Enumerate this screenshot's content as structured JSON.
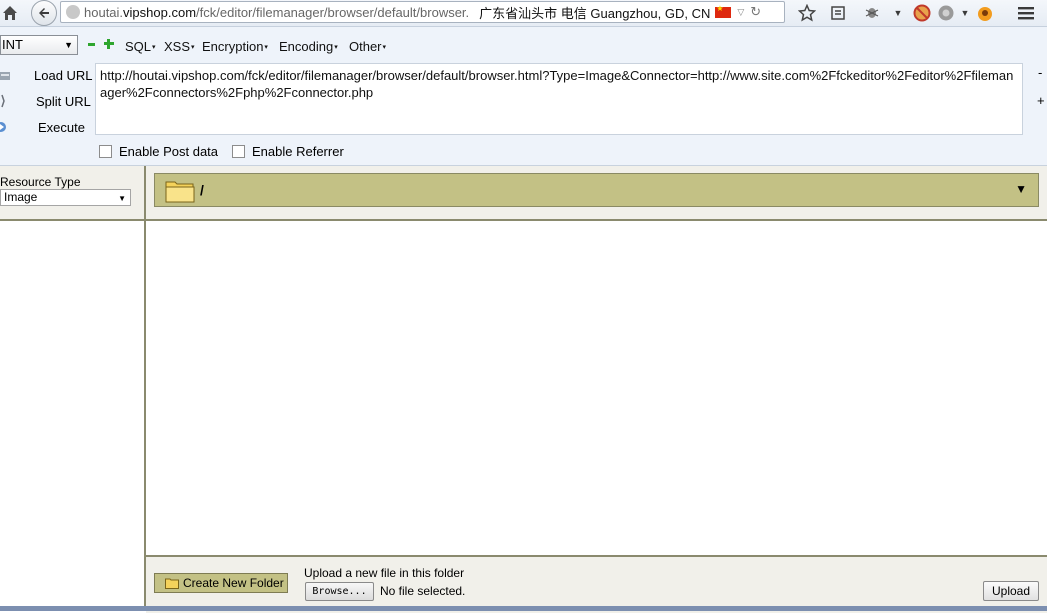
{
  "browser": {
    "url_prefix": "houtai.",
    "url_domain": "vipshop.com",
    "url_path": "/fck/editor/filemanager/browser/default/browser.",
    "geo_info": "广东省汕头市 电信   Guangzhou, GD, CN"
  },
  "hackbar": {
    "type_select": "INT",
    "menus": [
      "SQL",
      "XSS",
      "Encryption",
      "Encoding",
      "Other"
    ],
    "load_url": "Load URL",
    "split_url": "Split URL",
    "execute": "Execute",
    "url_value": "http://houtai.vipshop.com/fck/editor/filemanager/browser/default/browser.html?Type=Image&Connector=http://www.site.com%2Ffckeditor%2Feditor%2Ffilemanager%2Fconnectors%2Fphp%2Fconnector.php",
    "side_minus": "-",
    "side_plus": "+",
    "enable_post": "Enable Post data",
    "enable_referrer": "Enable Referrer"
  },
  "filemanager": {
    "resource_type_label": "Resource Type",
    "resource_type_value": "Image",
    "current_path": "/",
    "create_folder": "Create New Folder",
    "upload_label": "Upload a new file in this folder",
    "browse": "Browse...",
    "file_status": "No file selected.",
    "upload": "Upload"
  },
  "colors": {
    "accent_olive": "#c3c185",
    "panel_bg": "#f1f0ea",
    "hackbar_bg": "#eef3fa"
  }
}
